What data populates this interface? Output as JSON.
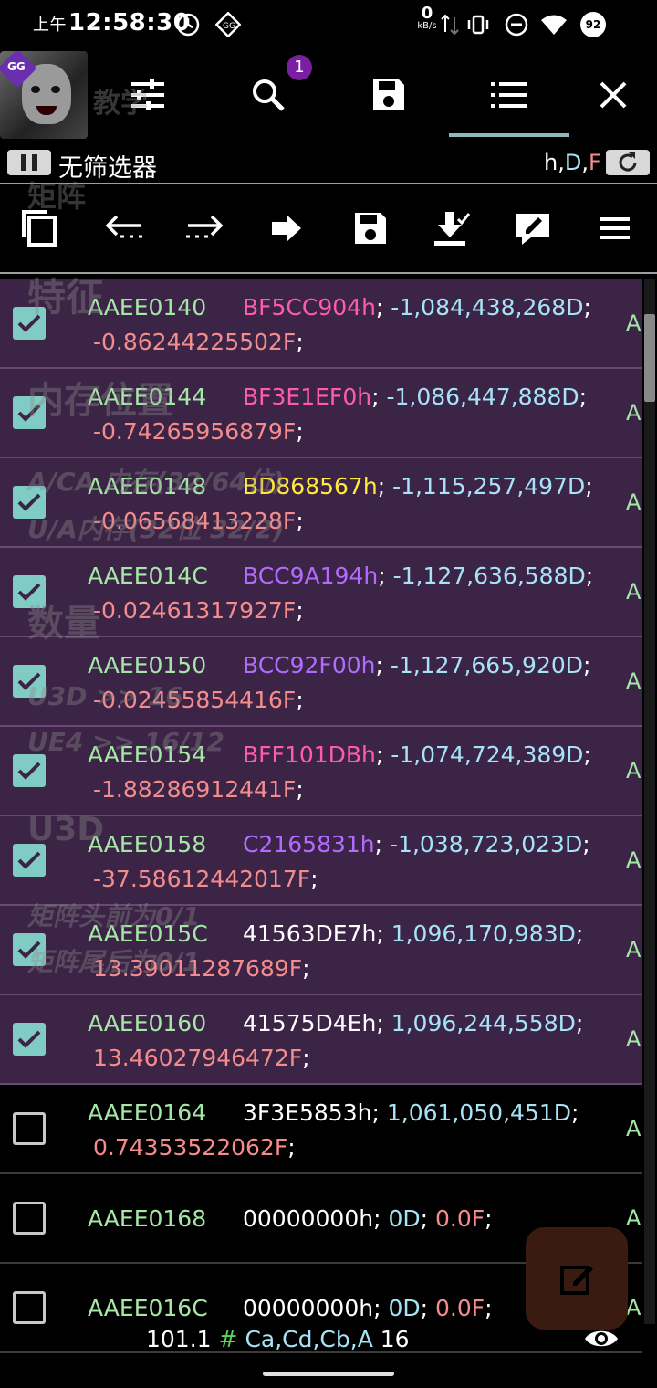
{
  "status_bar": {
    "period": "上午",
    "time": "12:58:30",
    "net_speed_value": "0",
    "net_speed_unit": "kB/s",
    "battery": "92",
    "icons": [
      "alarm-icon",
      "gg-notification-icon",
      "data-arrows-icon",
      "vibrate-icon",
      "dnd-icon",
      "wifi-icon",
      "battery-icon"
    ]
  },
  "toolbar": {
    "search_badge": "1",
    "icons": [
      "app-icon",
      "settings-sliders-icon",
      "search-icon",
      "save-icon",
      "list-icon",
      "close-icon"
    ]
  },
  "filter_bar": {
    "filter_text": "无筛选器",
    "type_h": "h",
    "type_d": "D",
    "type_f": "F",
    "separator": ","
  },
  "action_icons": [
    "copy-icon",
    "step-back-icon",
    "step-forward-icon",
    "go-arrow-icon",
    "save-list-icon",
    "load-icon",
    "edit-selected-icon",
    "menu-icon"
  ],
  "watermark": [
    "教学",
    "矩阵",
    "特征",
    "内存位置",
    "A/CA 内存(32/64位)",
    "U/A内存(32位 32/2)",
    "数量",
    "U3D >> 16",
    "UE4 >> 16/12",
    "U3D",
    "矩阵头前为0/1",
    "矩阵尾后为0/1"
  ],
  "rows": [
    {
      "checked": true,
      "address": "AAEE0140",
      "hex": "BF5CC904h",
      "hex_color": "#ff5bad",
      "dword": "-1,084,438,268D",
      "float": "-0.86244225502F",
      "region": "A"
    },
    {
      "checked": true,
      "address": "AAEE0144",
      "hex": "BF3E1EF0h",
      "hex_color": "#ff5bad",
      "dword": "-1,086,447,888D",
      "float": "-0.74265956879F",
      "region": "A"
    },
    {
      "checked": true,
      "address": "AAEE0148",
      "hex": "BD868567h",
      "hex_color": "#ffeb3b",
      "dword": "-1,115,257,497D",
      "float": "-0.06568413228F",
      "region": "A"
    },
    {
      "checked": true,
      "address": "AAEE014C",
      "hex": "BCC9A194h",
      "hex_color": "#b36bff",
      "dword": "-1,127,636,588D",
      "float": "-0.02461317927F",
      "region": "A"
    },
    {
      "checked": true,
      "address": "AAEE0150",
      "hex": "BCC92F00h",
      "hex_color": "#b36bff",
      "dword": "-1,127,665,920D",
      "float": "-0.02455854416F",
      "region": "A"
    },
    {
      "checked": true,
      "address": "AAEE0154",
      "hex": "BFF101DBh",
      "hex_color": "#ff5bad",
      "dword": "-1,074,724,389D",
      "float": "-1.88286912441F",
      "region": "A"
    },
    {
      "checked": true,
      "address": "AAEE0158",
      "hex": "C2165831h",
      "hex_color": "#b36bff",
      "dword": "-1,038,723,023D",
      "float": "-37.58612442017F",
      "region": "A"
    },
    {
      "checked": true,
      "address": "AAEE015C",
      "hex": "41563DE7h",
      "hex_color": "#ffffff",
      "dword": "1,096,170,983D",
      "float": "13.39011287689F",
      "region": "A"
    },
    {
      "checked": true,
      "address": "AAEE0160",
      "hex": "41575D4Eh",
      "hex_color": "#ffffff",
      "dword": "1,096,244,558D",
      "float": "13.46027946472F",
      "region": "A"
    },
    {
      "checked": false,
      "address": "AAEE0164",
      "hex": "3F3E5853h",
      "hex_color": "#ffffff",
      "dword": "1,061,050,451D",
      "float": "0.74353522062F",
      "region": "A"
    },
    {
      "checked": false,
      "address": "AAEE0168",
      "hex": "00000000h",
      "hex_color": "#ffffff",
      "dword": "0D",
      "float": "0.0F",
      "region": "A",
      "single_line": true
    },
    {
      "checked": false,
      "address": "AAEE016C",
      "hex": "00000000h",
      "hex_color": "#ffffff",
      "dword": "0D",
      "float": "0.0F",
      "region": "A",
      "single_line": true
    }
  ],
  "bottom_info": {
    "version": "101.1",
    "hash": "#",
    "regions": "Ca,Cd,Cb,A",
    "count": "16"
  }
}
